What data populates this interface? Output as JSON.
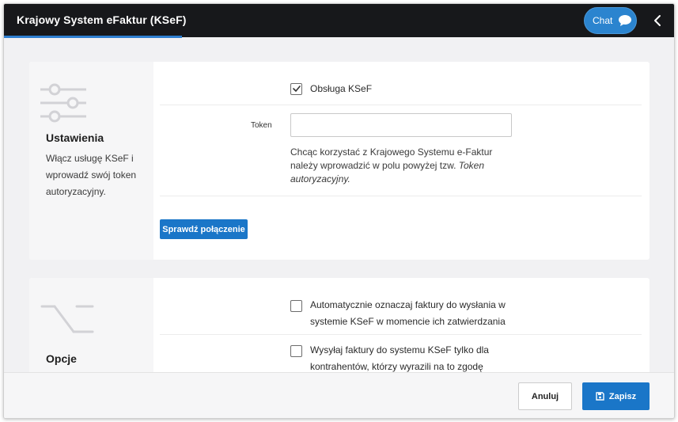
{
  "header": {
    "title": "Krajowy System eFaktur (KSeF)",
    "chat_label": "Chat",
    "accent_color": "#2e7fd0",
    "icons": [
      "chat-bubble-icon",
      "chevron-left-icon"
    ]
  },
  "settings_card": {
    "icon": "sliders-icon",
    "title": "Ustawienia",
    "description": "Włącz usługę KSeF i wprowadź swój token autoryzacyjny.",
    "ksef_checkbox": {
      "label": "Obsługa KSeF",
      "checked": true
    },
    "token": {
      "label": "Token",
      "value": "",
      "help_prefix": "Chcąc korzystać z Krajowego Systemu e-Faktur należy wprowadzić w polu powyżej tzw.",
      "help_emphasis": "Token autoryzacyjny."
    },
    "check_connection_label": "Sprawdź połączenie"
  },
  "options_card": {
    "icon": "switch-route-icon",
    "title": "Opcje",
    "auto_mark": {
      "label": "Automatycznie oznaczaj faktury do wysłania w systemie KSeF w momencie ich zatwierdzania",
      "checked": false
    },
    "send_consent": {
      "label": "Wysyłaj faktury do systemu KSeF tylko dla kontrahentów, którzy wyrazili na to zgodę",
      "checked": false
    }
  },
  "footer": {
    "cancel_label": "Anuluj",
    "save_label": "Zapisz",
    "save_icon": "floppy-disk-icon",
    "primary_color": "#1a76c8"
  }
}
